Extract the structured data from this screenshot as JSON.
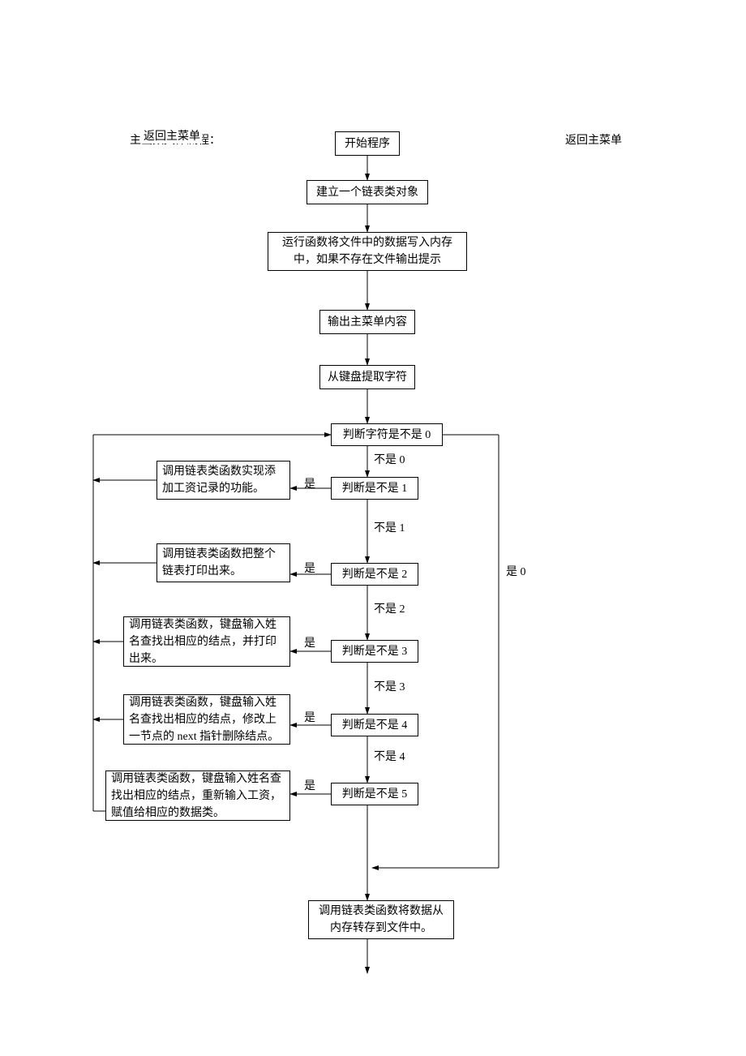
{
  "chart_data": {
    "type": "flowchart",
    "nodes": [
      {
        "id": "title",
        "text": "主函数具体流程：",
        "type": "text"
      },
      {
        "id": "return1",
        "text": "返回主菜单",
        "type": "text"
      },
      {
        "id": "return2",
        "text": "返回主菜单",
        "type": "text"
      },
      {
        "id": "start",
        "text": "开始程序",
        "type": "process"
      },
      {
        "id": "create",
        "text": "建立一个链表类对象",
        "type": "process"
      },
      {
        "id": "load",
        "text": "运行函数将文件中的数据写入内存中，如果不存在文件输出提示",
        "type": "process"
      },
      {
        "id": "menu",
        "text": "输出主菜单内容",
        "type": "process"
      },
      {
        "id": "input",
        "text": "从键盘提取字符",
        "type": "process"
      },
      {
        "id": "check0",
        "text": "判断字符是不是 0",
        "type": "decision"
      },
      {
        "id": "check1",
        "text": "判断是不是 1",
        "type": "decision"
      },
      {
        "id": "check2",
        "text": "判断是不是 2",
        "type": "decision"
      },
      {
        "id": "check3",
        "text": "判断是不是 3",
        "type": "decision"
      },
      {
        "id": "check4",
        "text": "判断是不是 4",
        "type": "decision"
      },
      {
        "id": "check5",
        "text": "判断是不是 5",
        "type": "decision"
      },
      {
        "id": "action1",
        "text": "调用链表类函数实现添加工资记录的功能。",
        "type": "process"
      },
      {
        "id": "action2",
        "text": "调用链表类函数把整个链表打印出来。",
        "type": "process"
      },
      {
        "id": "action3",
        "text": "调用链表类函数，键盘输入姓名查找出相应的结点，并打印出来。",
        "type": "process"
      },
      {
        "id": "action4",
        "text": "调用链表类函数，键盘输入姓名查找出相应的结点，修改上一节点的 next 指针删除结点。",
        "type": "process"
      },
      {
        "id": "action5",
        "text": "调用链表类函数，键盘输入姓名查找出相应的结点，重新输入工资，赋值给相应的数据类。",
        "type": "process"
      },
      {
        "id": "save",
        "text": "调用链表类函数将数据从内存转存到文件中。",
        "type": "process"
      }
    ],
    "edges": [
      {
        "from": "start",
        "to": "create"
      },
      {
        "from": "create",
        "to": "load"
      },
      {
        "from": "load",
        "to": "menu"
      },
      {
        "from": "menu",
        "to": "input"
      },
      {
        "from": "input",
        "to": "check0"
      },
      {
        "from": "check0",
        "to": "check1",
        "label": "不是 0"
      },
      {
        "from": "check0",
        "to": "save",
        "label": "是 0"
      },
      {
        "from": "check1",
        "to": "action1",
        "label": "是"
      },
      {
        "from": "check1",
        "to": "check2",
        "label": "不是 1"
      },
      {
        "from": "check2",
        "to": "action2",
        "label": "是"
      },
      {
        "from": "check2",
        "to": "check3",
        "label": "不是 2"
      },
      {
        "from": "check3",
        "to": "action3",
        "label": "是"
      },
      {
        "from": "check3",
        "to": "check4",
        "label": "不是 3"
      },
      {
        "from": "check4",
        "to": "action4",
        "label": "是"
      },
      {
        "from": "check4",
        "to": "check5",
        "label": "不是 4"
      },
      {
        "from": "check5",
        "to": "action5",
        "label": "是"
      },
      {
        "from": "check5",
        "to": "save"
      }
    ]
  },
  "labels": {
    "title": "主函数具体流程：",
    "return1": "返回主菜单",
    "return2": "返回主菜单",
    "yes": "是",
    "not0": "不是 0",
    "not1": "不是 1",
    "not2": "不是 2",
    "not3": "不是 3",
    "not4": "不是 4",
    "is0": "是 0"
  },
  "boxes": {
    "start": "开始程序",
    "create": "建立一个链表类对象",
    "load": "运行函数将文件中的数据写入内存中，如果不存在文件输出提示",
    "menu": "输出主菜单内容",
    "input": "从键盘提取字符",
    "check0": "判断字符是不是 0",
    "check1": "判断是不是 1",
    "check2": "判断是不是 2",
    "check3": "判断是不是 3",
    "check4": "判断是不是 4",
    "check5": "判断是不是 5",
    "action1": "调用链表类函数实现添加工资记录的功能。",
    "action2": "调用链表类函数把整个链表打印出来。",
    "action3": "调用链表类函数，键盘输入姓名查找出相应的结点，并打印出来。",
    "action4": "调用链表类函数，键盘输入姓名查找出相应的结点，修改上一节点的 next 指针删除结点。",
    "action5": "调用链表类函数，键盘输入姓名查找出相应的结点，重新输入工资，赋值给相应的数据类。",
    "save": "调用链表类函数将数据从内存转存到文件中。"
  }
}
